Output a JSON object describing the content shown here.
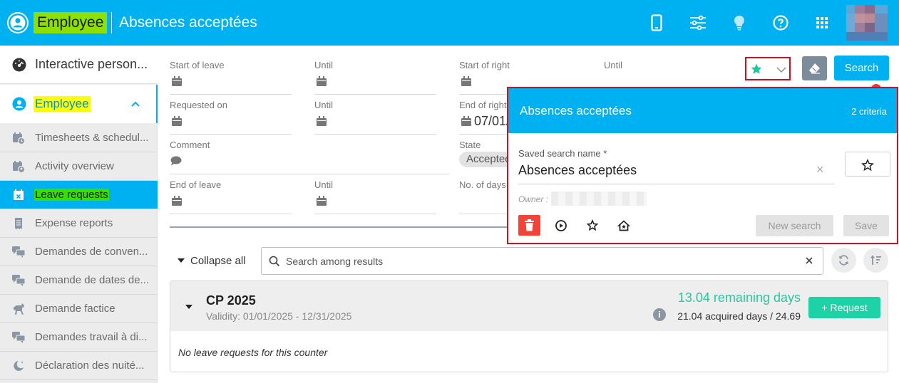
{
  "header": {
    "app_title": "Employee",
    "page_title": "Absences acceptées",
    "icons": [
      "mobile-icon",
      "settings-sliders-icon",
      "lightbulb-icon",
      "help-icon",
      "apps-grid-icon"
    ]
  },
  "sidebar": {
    "top_item": "Interactive person...",
    "section": "Employee",
    "items": [
      {
        "label": "Timesheets & schedul...",
        "icon": "calendar-clock-icon"
      },
      {
        "label": "Activity overview",
        "icon": "calendar-user-icon"
      },
      {
        "label": "Leave requests",
        "icon": "calendar-x-icon",
        "active": true
      },
      {
        "label": "Expense reports",
        "icon": "receipt-icon"
      },
      {
        "label": "Demandes de conven...",
        "icon": "chat-icon"
      },
      {
        "label": "Demande de dates de...",
        "icon": "chat-icon"
      },
      {
        "label": "Demande factice",
        "icon": "horse-icon"
      },
      {
        "label": "Demandes travail à di...",
        "icon": "chat-icon"
      },
      {
        "label": "Déclaration des nuité...",
        "icon": "moon-icon"
      }
    ]
  },
  "filters": {
    "start_of_leave": "Start of leave",
    "until": "Until",
    "start_of_right": "Start of right",
    "requested_on": "Requested on",
    "end_of_right": "End of right",
    "end_of_right_value": "07/01/",
    "comment": "Comment",
    "state": "State",
    "state_value": "Accepted",
    "end_of_leave": "End of leave",
    "no_of_days": "No. of days"
  },
  "toolbar": {
    "search_label": "Search"
  },
  "popup": {
    "title": "Absences acceptées",
    "criteria": "2 criteria",
    "name_label": "Saved search name *",
    "name_value": "Absences acceptées",
    "clear": "×",
    "owner_label": "Owner :",
    "new_search": "New search",
    "save": "Save"
  },
  "results": {
    "collapse_all": "Collapse all",
    "search_placeholder": "Search among results",
    "counter": {
      "name": "CP 2025",
      "validity": "Validity: 01/01/2025 - 12/31/2025",
      "remaining": "13.04 remaining days",
      "acquired": "21.04 acquired days / 24.69",
      "request_button": "+ Request",
      "empty_text": "No leave requests for this counter"
    }
  },
  "colors": {
    "primary": "#00b1f2",
    "highlight_green": "#8ee000",
    "highlight_yellow": "#ffff00",
    "success": "#2ec4a0",
    "danger": "#f44336"
  }
}
